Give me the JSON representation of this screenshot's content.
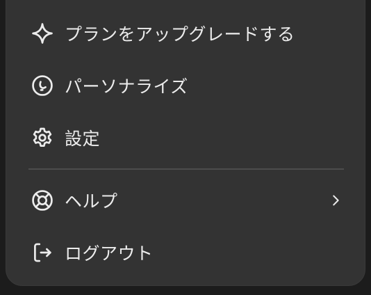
{
  "menu": {
    "items": [
      {
        "label": "プランをアップグレードする",
        "icon": "sparkle-icon"
      },
      {
        "label": "パーソナライズ",
        "icon": "personalize-icon"
      },
      {
        "label": "設定",
        "icon": "gear-icon"
      },
      {
        "label": "ヘルプ",
        "icon": "lifebuoy-icon",
        "has_submenu": true
      },
      {
        "label": "ログアウト",
        "icon": "logout-icon"
      }
    ]
  },
  "colors": {
    "menu_background": "#333333",
    "page_background": "#1c1c1c",
    "text": "#ececec",
    "divider": "#4d4d4d"
  }
}
